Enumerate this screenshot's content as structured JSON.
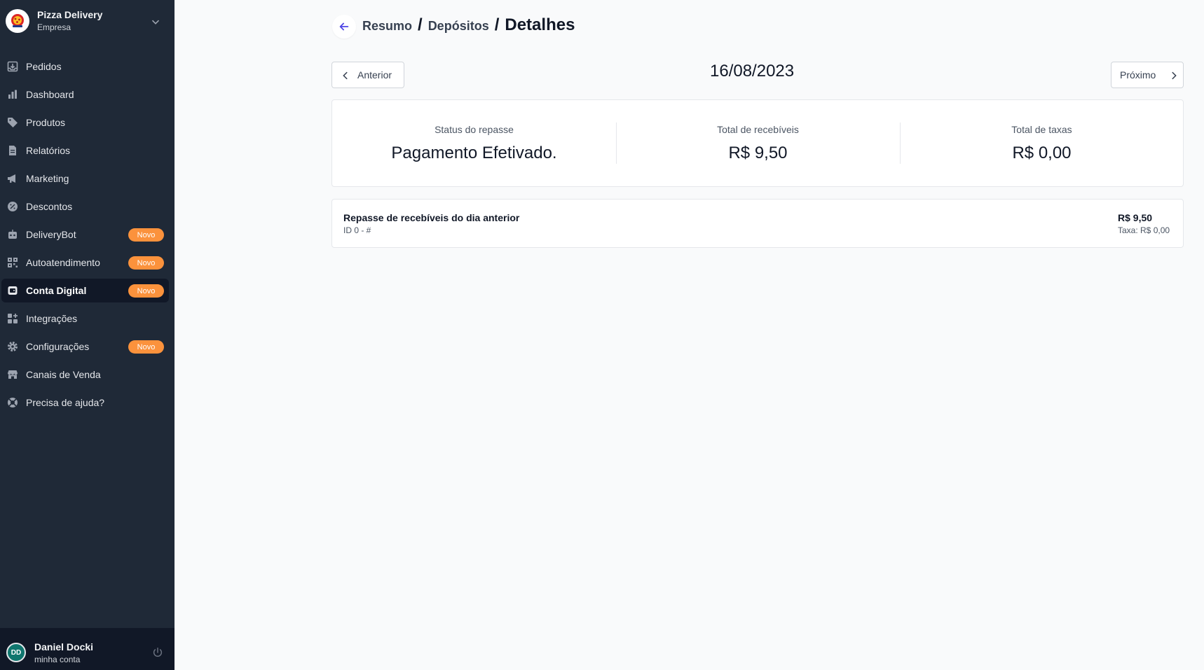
{
  "brand": {
    "name": "Pizza Delivery",
    "subtitle": "Empresa"
  },
  "nav": {
    "items": [
      {
        "label": "Pedidos",
        "icon": "inbox-download-icon"
      },
      {
        "label": "Dashboard",
        "icon": "bar-chart-icon"
      },
      {
        "label": "Produtos",
        "icon": "tag-icon"
      },
      {
        "label": "Relatórios",
        "icon": "document-icon"
      },
      {
        "label": "Marketing",
        "icon": "megaphone-icon"
      },
      {
        "label": "Descontos",
        "icon": "discount-badge-icon"
      },
      {
        "label": "DeliveryBot",
        "icon": "robot-icon",
        "badge": "Novo"
      },
      {
        "label": "Autoatendimento",
        "icon": "qr-code-icon",
        "badge": "Novo"
      },
      {
        "label": "Conta Digital",
        "icon": "wallet-icon",
        "badge": "Novo",
        "active": true
      },
      {
        "label": "Integrações",
        "icon": "puzzle-grid-icon"
      },
      {
        "label": "Configurações",
        "icon": "gear-icon",
        "badge": "Novo"
      },
      {
        "label": "Canais de Venda",
        "icon": "storefront-icon"
      },
      {
        "label": "Precisa de ajuda?",
        "icon": "lifebuoy-icon"
      }
    ]
  },
  "user": {
    "initials": "DD",
    "name": "Daniel Docki",
    "subtitle": "minha conta"
  },
  "breadcrumb": {
    "level1": "Resumo",
    "level2": "Depósitos",
    "current": "Detalhes",
    "separator": "/"
  },
  "pager": {
    "prev_label": "Anterior",
    "next_label": "Próximo",
    "date": "16/08/2023"
  },
  "summary": {
    "status_label": "Status do repasse",
    "status_value": "Pagamento Efetivado.",
    "receivables_label": "Total de recebíveis",
    "receivables_value": "R$ 9,50",
    "fees_label": "Total de taxas",
    "fees_value": "R$ 0,00"
  },
  "transactions": [
    {
      "title": "Repasse de recebíveis do dia anterior",
      "id": "ID 0 - #",
      "amount": "R$ 9,50",
      "fee": "Taxa: R$ 0,00"
    }
  ],
  "colors": {
    "sidebar": "#1f2937",
    "accent": "#4f46e5",
    "badge": "#fb923c",
    "background": "#f9fafb"
  }
}
